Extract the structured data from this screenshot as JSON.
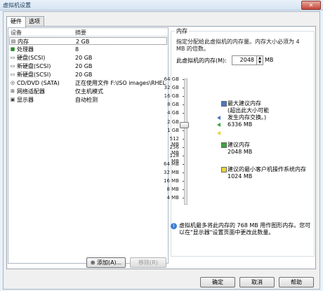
{
  "window": {
    "title": "虚拟机设置"
  },
  "tabs": [
    {
      "label": "硬件"
    },
    {
      "label": "选项"
    }
  ],
  "device_list": {
    "columns": {
      "device": "设备",
      "summary": "摘要"
    },
    "rows": [
      {
        "icon": "memory-icon",
        "name": "内存",
        "summary": "2 GB"
      },
      {
        "icon": "cpu-icon",
        "name": "处理器",
        "summary": "8"
      },
      {
        "icon": "disk-icon",
        "name": "硬盘(SCSI)",
        "summary": "20 GB"
      },
      {
        "icon": "disk-icon",
        "name": "新硬盘(SCSI)",
        "summary": "20 GB"
      },
      {
        "icon": "disk-icon",
        "name": "新硬盘(SCSI)",
        "summary": "20 GB"
      },
      {
        "icon": "cdrom-icon",
        "name": "CD/DVD (SATA)",
        "summary": "正在使用文件 F:\\ISO images\\RHEL-s..."
      },
      {
        "icon": "network-icon",
        "name": "网络适配器",
        "summary": "仅主机模式"
      },
      {
        "icon": "display-icon",
        "name": "显示器",
        "summary": "自动检测"
      }
    ],
    "add_button": "添加(A)...",
    "remove_button": "移除(R)"
  },
  "memory": {
    "group_title": "内存",
    "description": "指定分配给此虚拟机的内存量。内存大小必须为 4 MB 的倍数。",
    "field_label": "此虚拟机的内存(M):",
    "value": "2048",
    "unit": "MB",
    "scale": [
      "64 GB",
      "32 GB",
      "16 GB",
      "8 GB",
      "4 GB",
      "2 GB",
      "1 GB",
      "512 MB",
      "256 MB",
      "128 MB",
      "64 MB",
      "32 MB",
      "16 MB",
      "8 MB",
      "4 MB"
    ],
    "legend": [
      {
        "color": "#4a78c2",
        "title": "最大建议内存",
        "note": "(超出此大小可能\n发生内存交换。)",
        "value": "6336 MB"
      },
      {
        "color": "#3aa63a",
        "title": "建议内存",
        "value": "2048 MB"
      },
      {
        "color": "#e8d43a",
        "title": "建议的最小客户机操作系统内存",
        "value": "1024 MB"
      }
    ],
    "info": "虚拟机最多将此内存的 768 MB 用作图形内存。您可以在\"显示器\"设置页面中更改此数量。"
  },
  "footer": {
    "ok": "确定",
    "cancel": "取消",
    "help": "帮助"
  }
}
